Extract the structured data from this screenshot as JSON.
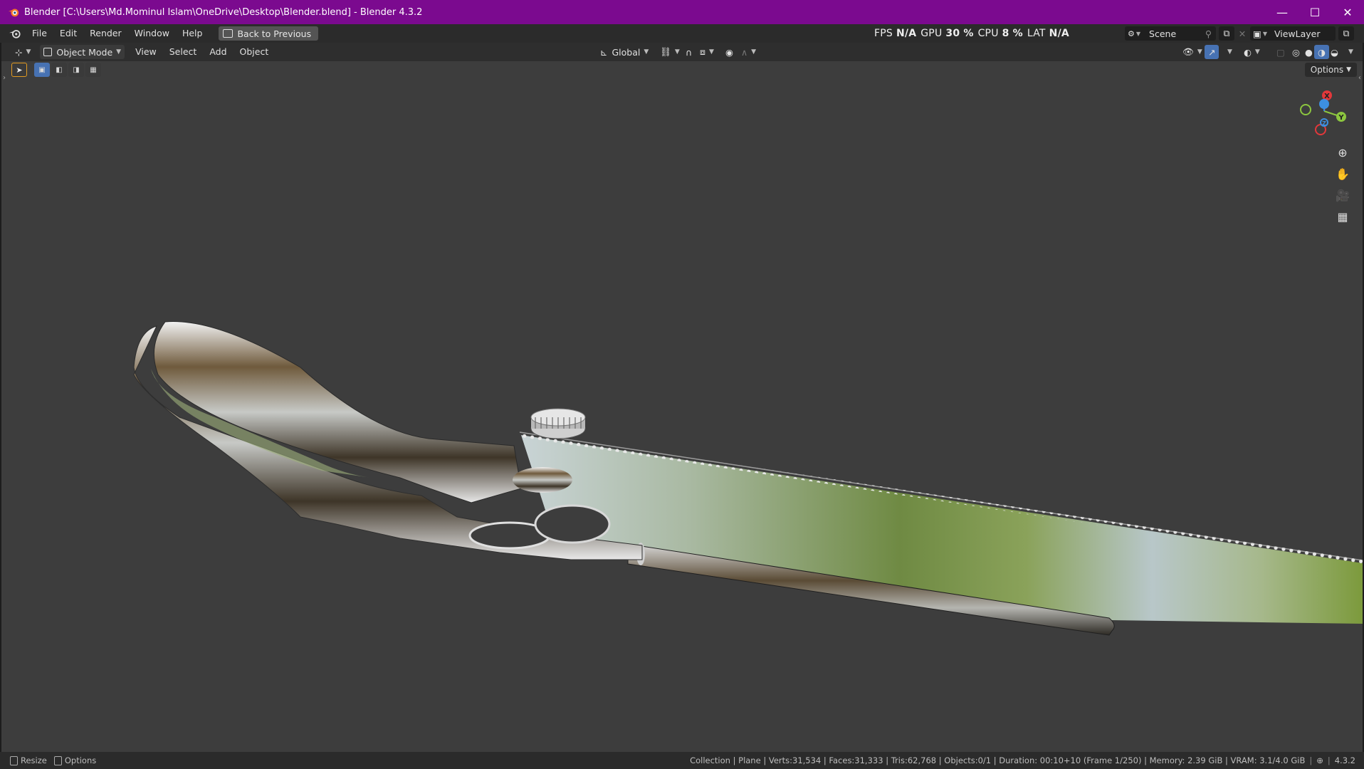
{
  "window": {
    "title": "Blender [C:\\Users\\Md.Mominul Islam\\OneDrive\\Desktop\\Blender.blend] - Blender 4.3.2",
    "minimize": "—",
    "maximize": "☐",
    "close": "✕"
  },
  "menubar": {
    "items": [
      "File",
      "Edit",
      "Render",
      "Window",
      "Help"
    ],
    "back_button": "Back to Previous"
  },
  "stats": {
    "fps_label": "FPS",
    "fps_value": "N/A",
    "gpu_label": "GPU",
    "gpu_value": "30 %",
    "cpu_label": "CPU",
    "cpu_value": "8 %",
    "lat_label": "LAT",
    "lat_value": "N/A"
  },
  "scene": {
    "name": "Scene"
  },
  "view_layer": {
    "name": "ViewLayer"
  },
  "viewport_header": {
    "mode": "Object Mode",
    "menus": [
      "View",
      "Select",
      "Add",
      "Object"
    ],
    "transform_orientation": "Global"
  },
  "viewport": {
    "options_label": "Options",
    "gizmo": {
      "x": "X",
      "y": "Y",
      "z": "Z"
    },
    "colors": {
      "x": "#e3383b",
      "y": "#8cc63f",
      "z": "#3d8fe0",
      "background": "#3d3d3d"
    }
  },
  "statusbar": {
    "left": [
      "Resize",
      "Options"
    ],
    "right": "Collection | Plane | Verts:31,534 | Faces:31,333 | Tris:62,768 | Objects:0/1 | Duration: 00:10+10 (Frame 1/250) | Memory: 2.39 GiB | VRAM: 3.1/4.0 GiB",
    "version": "4.3.2"
  }
}
